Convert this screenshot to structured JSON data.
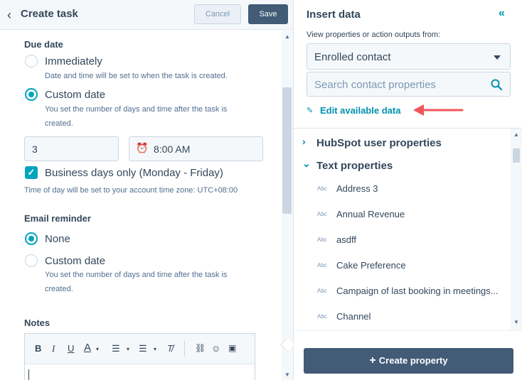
{
  "left": {
    "title": "Create task",
    "cancel_label": "Cancel",
    "save_label": "Save",
    "due_date": {
      "label": "Due date",
      "options": [
        {
          "label": "Immediately",
          "help": "Date and time will be set to when the task is created.",
          "selected": false
        },
        {
          "label": "Custom date",
          "help": "You set the number of days and time after the task is created.",
          "selected": true
        }
      ],
      "days_value": "3",
      "time_value": "8:00 AM",
      "business_days_label": "Business days only (Monday - Friday)",
      "business_days_checked": true,
      "timezone_note": "Time of day will be set to your account time zone: UTC+08:00"
    },
    "email_reminder": {
      "label": "Email reminder",
      "options": [
        {
          "label": "None",
          "selected": true
        },
        {
          "label": "Custom date",
          "help": "You set the number of days and time after the task is created.",
          "selected": false
        }
      ]
    },
    "notes": {
      "label": "Notes",
      "toolbar": [
        "B",
        "I",
        "U",
        "A"
      ]
    }
  },
  "right": {
    "title": "Insert data",
    "view_label": "View properties or action outputs from:",
    "selected_source": "Enrolled contact",
    "search_placeholder": "Search contact properties",
    "edit_link": "Edit available data",
    "groups": [
      {
        "label": "HubSpot user properties",
        "expanded": false
      },
      {
        "label": "Text properties",
        "expanded": true
      }
    ],
    "type_tag": "Abc",
    "properties": [
      "Address 3",
      "Annual Revenue",
      "asdff",
      "Cake Preference",
      "Campaign of last booking in meetings...",
      "Channel"
    ],
    "create_button": "Create property"
  },
  "colors": {
    "accent": "#00a4bd",
    "link": "#0091ae",
    "primary_button": "#425b76",
    "annotation_arrow": "#f2545b"
  }
}
